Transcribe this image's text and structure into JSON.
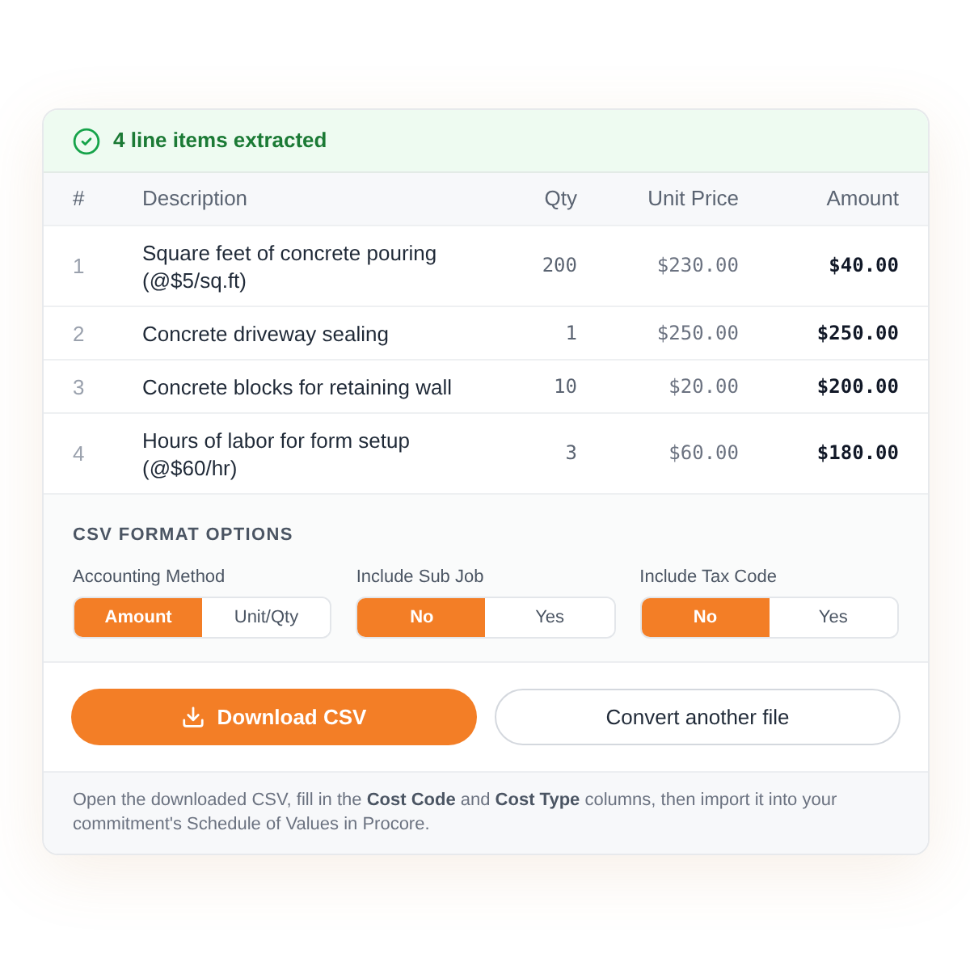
{
  "banner": {
    "text": "4 line items extracted"
  },
  "table": {
    "columns": [
      "#",
      "Description",
      "Qty",
      "Unit Price",
      "Amount"
    ],
    "rows": [
      {
        "index": "1",
        "description": "Square feet of concrete pouring (@$5/sq.ft)",
        "qty": "200",
        "unit_price": "$230.00",
        "amount": "$40.00"
      },
      {
        "index": "2",
        "description": "Concrete driveway sealing",
        "qty": "1",
        "unit_price": "$250.00",
        "amount": "$250.00"
      },
      {
        "index": "3",
        "description": "Concrete blocks for retaining wall",
        "qty": "10",
        "unit_price": "$20.00",
        "amount": "$200.00"
      },
      {
        "index": "4",
        "description": "Hours of labor for form setup (@$60/hr)",
        "qty": "3",
        "unit_price": "$60.00",
        "amount": "$180.00"
      }
    ]
  },
  "options": {
    "heading": "CSV FORMAT OPTIONS",
    "groups": [
      {
        "label": "Accounting Method",
        "choices": [
          {
            "label": "Amount",
            "selected": true
          },
          {
            "label": "Unit/Qty",
            "selected": false
          }
        ]
      },
      {
        "label": "Include Sub Job",
        "choices": [
          {
            "label": "No",
            "selected": true
          },
          {
            "label": "Yes",
            "selected": false
          }
        ]
      },
      {
        "label": "Include Tax Code",
        "choices": [
          {
            "label": "No",
            "selected": true
          },
          {
            "label": "Yes",
            "selected": false
          }
        ]
      }
    ]
  },
  "actions": [
    {
      "label": "Download CSV",
      "kind": "primary"
    },
    {
      "label": "Convert another file",
      "kind": "secondary"
    }
  ],
  "footer": {
    "text": "Open the downloaded CSV, fill in the **Cost Code** and **Cost Type** columns, then import it into your commitment's Schedule of Values in Procore."
  }
}
